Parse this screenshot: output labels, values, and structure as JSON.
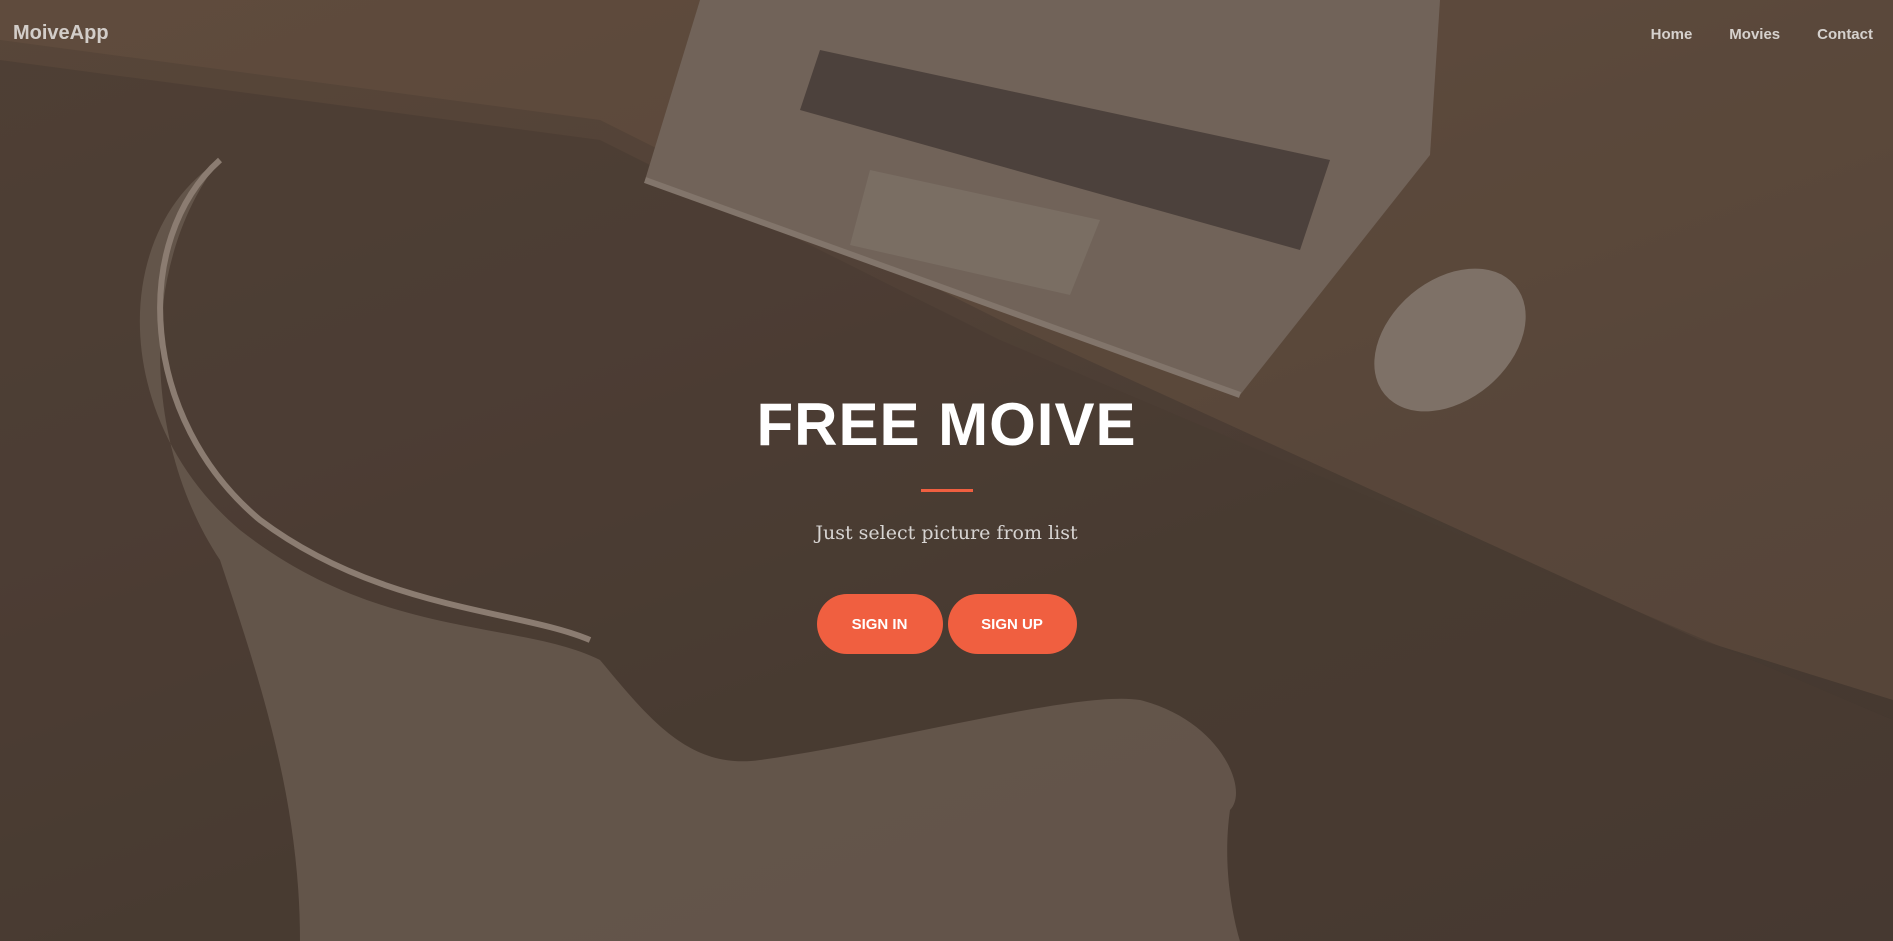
{
  "brand": {
    "name": "MoiveApp"
  },
  "nav": {
    "items": [
      {
        "label": "Home"
      },
      {
        "label": "Movies"
      },
      {
        "label": "Contact"
      }
    ]
  },
  "hero": {
    "title": "FREE MOIVE",
    "subtitle": "Just select picture from list",
    "buttons": {
      "sign_in": "SIGN IN",
      "sign_up": "SIGN UP"
    }
  },
  "colors": {
    "accent": "#f05f40",
    "overlay_tone": "#4d4037"
  }
}
